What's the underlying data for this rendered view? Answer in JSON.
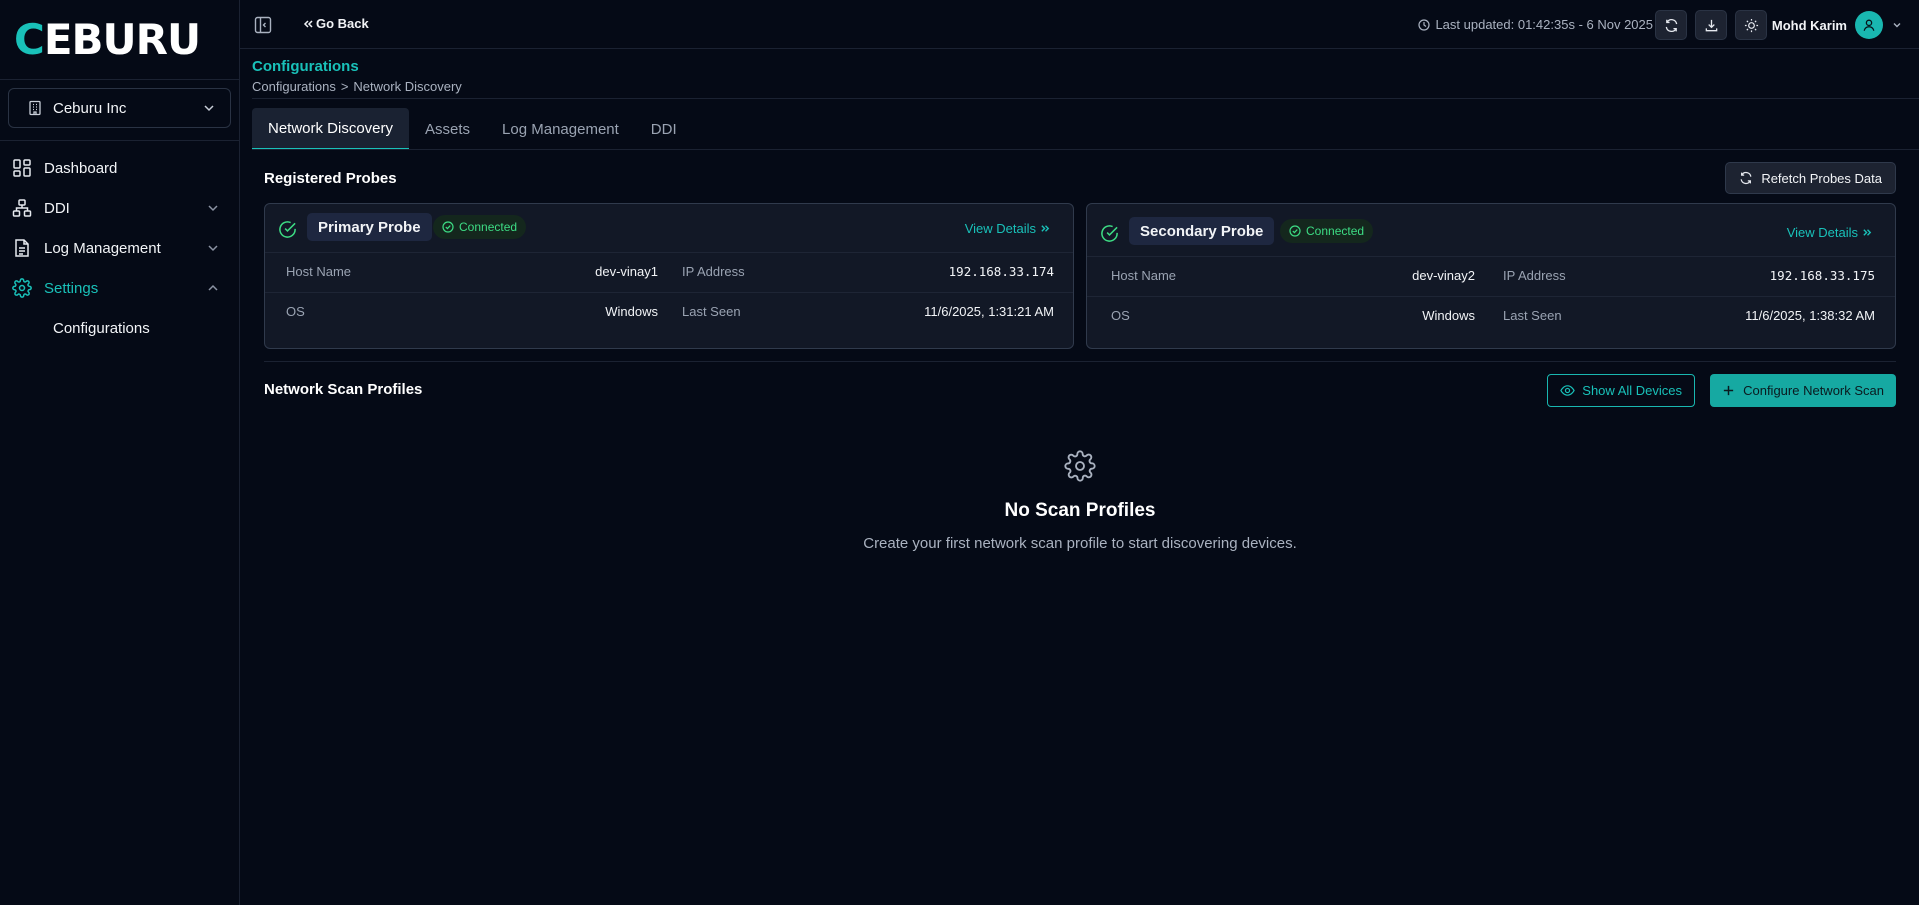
{
  "brand": {
    "logo_first": "C",
    "logo_rest": "EBURU",
    "accent_color": "#19c1b9"
  },
  "sidebar": {
    "org": "Ceburu Inc",
    "items": [
      {
        "label": "Dashboard",
        "icon": "dashboard-icon"
      },
      {
        "label": "DDI",
        "icon": "network-icon"
      },
      {
        "label": "Log Management",
        "icon": "document-icon"
      },
      {
        "label": "Settings",
        "icon": "gear-icon"
      }
    ],
    "sub_items": [
      {
        "label": "Configurations"
      }
    ]
  },
  "topbar": {
    "go_back": "Go Back",
    "last_updated": "Last updated: 01:42:35s - 6 Nov 2025",
    "user_name": "Mohd Karim"
  },
  "page": {
    "title": "Configurations",
    "breadcrumb": [
      "Configurations",
      ">",
      "Network Discovery"
    ]
  },
  "tabs": [
    {
      "label": "Network Discovery",
      "active": true
    },
    {
      "label": "Assets"
    },
    {
      "label": "Log Management"
    },
    {
      "label": "DDI"
    }
  ],
  "probes": {
    "title": "Registered Probes",
    "refetch_label": "Refetch Probes Data",
    "status_color": "#3ddc84",
    "list": [
      {
        "name": "Primary Probe",
        "status": "Connected",
        "view_details": "View Details",
        "host_label": "Host Name",
        "host": "dev-vinay1",
        "ip_label": "IP Address",
        "ip": "192.168.33.174",
        "os_label": "OS",
        "os": "Windows",
        "seen_label": "Last Seen",
        "seen": "11/6/2025, 1:31:21 AM"
      },
      {
        "name": "Secondary Probe",
        "status": "Connected",
        "view_details": "View Details",
        "host_label": "Host Name",
        "host": "dev-vinay2",
        "ip_label": "IP Address",
        "ip": "192.168.33.175",
        "os_label": "OS",
        "os": "Windows",
        "seen_label": "Last Seen",
        "seen": "11/6/2025, 1:38:32 AM"
      }
    ]
  },
  "scan_profiles": {
    "title": "Network Scan Profiles",
    "show_all_label": "Show All Devices",
    "configure_label": "Configure Network Scan",
    "empty_title": "No Scan Profiles",
    "empty_desc": "Create your first network scan profile to start discovering devices."
  }
}
